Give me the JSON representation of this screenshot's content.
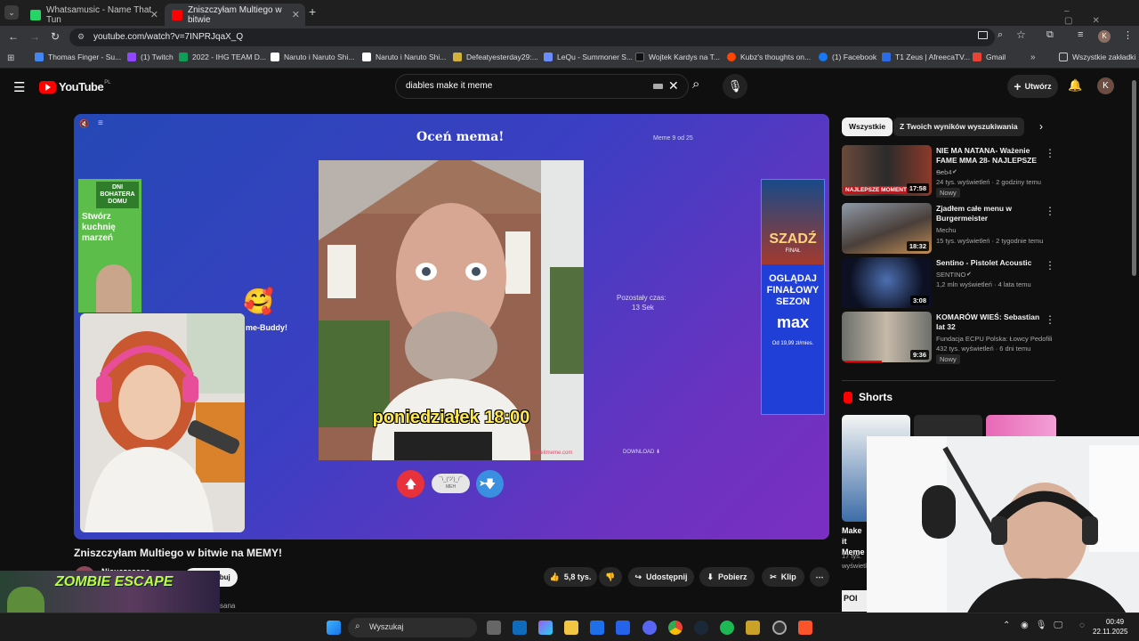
{
  "browser": {
    "tabs": [
      {
        "title": "Whatsamusic - Name That Tun"
      },
      {
        "title": "Zniszczyłam Multiego w bitwie"
      }
    ],
    "url": "youtube.com/watch?v=7INPRJqaX_Q",
    "bookmarks": [
      "Thomas Finger - Su...",
      "(1) Twitch",
      "2022 - IHG TEAM D...",
      "Naruto i Naruto Shi...",
      "Naruto i Naruto Shi...",
      "Defeatyesterday29:...",
      "LeQu - Summoner S...",
      "Wojtek Kardys na T...",
      "Kubz's thoughts on...",
      "(1) Facebook",
      "T1 Zeus | AfreecaTV...",
      "Gmail"
    ],
    "all_bookmarks": "Wszystkie zakładki"
  },
  "youtube": {
    "logo": "YouTube",
    "region": "PL",
    "search_value": "diables make it meme",
    "create_label": "Utwórz",
    "avatar_letter": "K"
  },
  "game": {
    "heading": "Oceń mema!",
    "counter": "Meme 9 od 25",
    "time_label": "Pozostały czas:",
    "time_value": "13 Sek",
    "meme_caption": "poniedziałek 18:00",
    "download": "DOWNLOAD",
    "meh": "MEH",
    "meh_face": "¯\\_(ツ)_/¯",
    "buddy": "me-Buddy!",
    "watermark": "makeitmeme.com",
    "ad_left_top": "DNI BOHATERA DOMU",
    "ad_left_text": "Stwórz kuchnię marzeń",
    "ad_right_title": "SZADŹ",
    "ad_right_finale": "FINAŁ",
    "ad_right_cta": "OGLĄDAJ FINAŁOWY SEZON",
    "ad_right_brand": "max",
    "ad_right_price": "Od 19,99 zł/mies."
  },
  "video": {
    "title": "Zniszczyłam Multiego w bitwie na MEMY!",
    "channel": "Nieuczesana",
    "channel_short": "sana",
    "subscribe": "Subskrybuj",
    "likes": "5,8 tys.",
    "share": "Udostępnij",
    "download": "Pobierz",
    "clip": "Klip"
  },
  "overlay": {
    "zombie_title": "ZOMBIE ESCAPE"
  },
  "filters": [
    "Wszystkie",
    "Z Twoich wyników wyszukiwania"
  ],
  "recommendations": [
    {
      "title": "NIE MA NATANA- Ważenie FAME MMA 28- NAJLEPSZE ...",
      "channel": "Seb4",
      "views": "24 tys. wyświetleń · 2 godziny temu",
      "badge": "Nowy",
      "duration": "17:58",
      "thumb_text": "NAJLEPSZE MOMENTY"
    },
    {
      "title": "Zjadłem całe menu w Burgermeister",
      "channel": "Mechu",
      "views": "15 tys. wyświetleń · 2 tygodnie temu",
      "badge": "",
      "duration": "18:32",
      "thumb_text": ""
    },
    {
      "title": "Sentino - Pistolet Acoustic",
      "channel": "SENTINO",
      "views": "1,2 mln wyświetleń · 4 lata temu",
      "badge": "",
      "duration": "3:08",
      "thumb_text": ""
    },
    {
      "title": "KOMARÓW WIEŚ: Sebastian lat 32",
      "channel": "Fundacja ECPU Polska: Łowcy Pedofili",
      "views": "432 tys. wyświetleń · 6 dni temu",
      "badge": "Nowy",
      "duration": "9:36",
      "thumb_text": ""
    }
  ],
  "shorts": {
    "heading": "Shorts",
    "item_title": "Make it Meme",
    "item_views": "17 tys. wyświetleń",
    "item_prefix": "POI"
  },
  "taskbar": {
    "search": "Wyszukaj",
    "time": "00:49",
    "date": "22.11.2025"
  }
}
